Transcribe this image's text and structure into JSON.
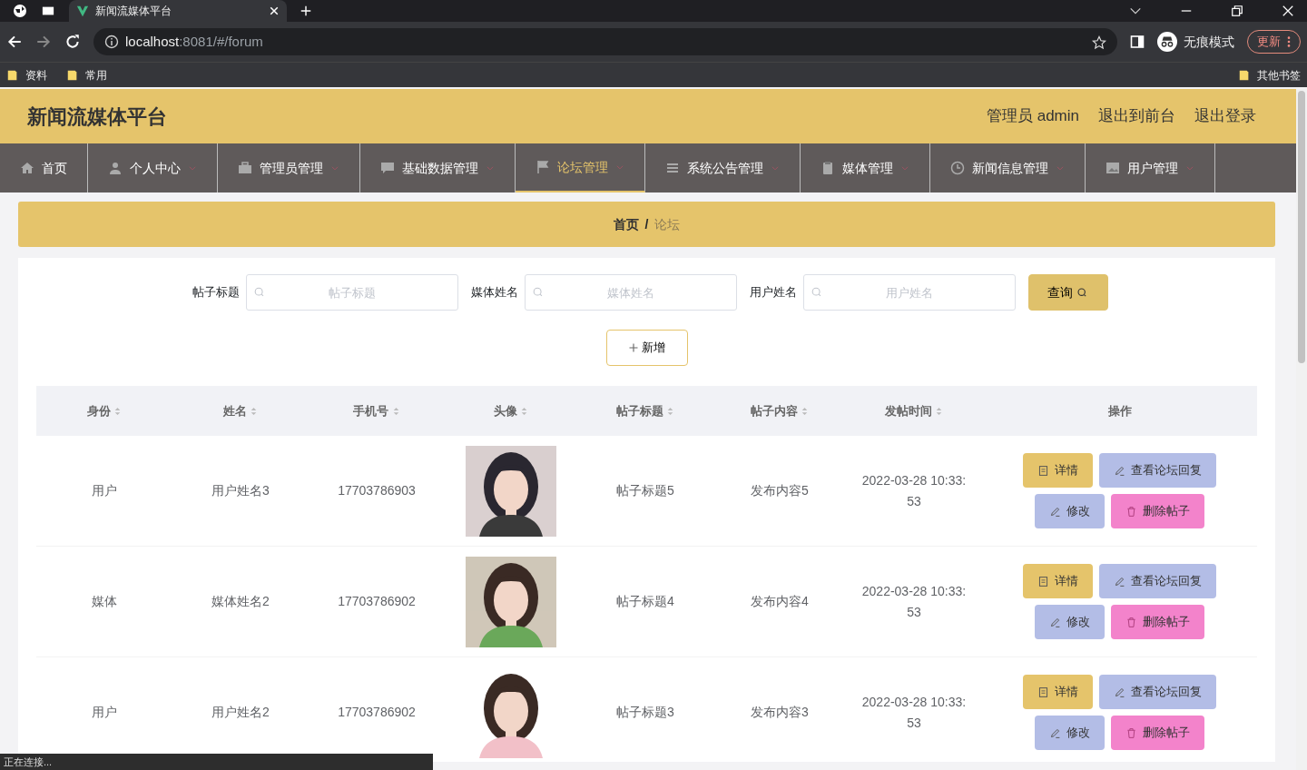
{
  "browser": {
    "tab_title": "新闻流媒体平台",
    "url_host": "localhost",
    "url_rest": ":8081/#/forum",
    "incognito_label": "无痕模式",
    "update_button": "更新",
    "bookmarks": [
      "资料",
      "常用"
    ],
    "other_bookmarks": "其他书签"
  },
  "header": {
    "title": "新闻流媒体平台",
    "user": "管理员 admin",
    "links": [
      "退出到前台",
      "退出登录"
    ]
  },
  "nav": [
    {
      "label": "首页",
      "selected": false,
      "dropdown": false
    },
    {
      "label": "个人中心",
      "selected": false,
      "dropdown": true
    },
    {
      "label": "管理员管理",
      "selected": false,
      "dropdown": true
    },
    {
      "label": "基础数据管理",
      "selected": false,
      "dropdown": true
    },
    {
      "label": "论坛管理",
      "selected": true,
      "dropdown": true
    },
    {
      "label": "系统公告管理",
      "selected": false,
      "dropdown": true
    },
    {
      "label": "媒体管理",
      "selected": false,
      "dropdown": true
    },
    {
      "label": "新闻信息管理",
      "selected": false,
      "dropdown": true
    },
    {
      "label": "用户管理",
      "selected": false,
      "dropdown": true
    }
  ],
  "breadcrumb": {
    "separator": "/",
    "items": [
      {
        "label": "首页",
        "current": false
      },
      {
        "label": "论坛",
        "current": true
      }
    ]
  },
  "search": {
    "fields": [
      {
        "label": "帖子标题",
        "placeholder": "帖子标题"
      },
      {
        "label": "媒体姓名",
        "placeholder": "媒体姓名"
      },
      {
        "label": "用户姓名",
        "placeholder": "用户姓名"
      }
    ],
    "button": "查询"
  },
  "add_button": "新增",
  "table": {
    "columns": [
      {
        "label": "身份",
        "sortable": true
      },
      {
        "label": "姓名",
        "sortable": true
      },
      {
        "label": "手机号",
        "sortable": true
      },
      {
        "label": "头像",
        "sortable": true
      },
      {
        "label": "帖子标题",
        "sortable": true
      },
      {
        "label": "帖子内容",
        "sortable": true
      },
      {
        "label": "发帖时间",
        "sortable": true
      },
      {
        "label": "操作",
        "sortable": false
      }
    ],
    "rows": [
      {
        "identity": "用户",
        "name": "用户姓名3",
        "phone": "17703786903",
        "title": "帖子标题5",
        "content": "发布内容5",
        "time": "2022-03-28 10:33:53",
        "actions": [
          {
            "kind": "detail",
            "label": "详情"
          },
          {
            "kind": "reply",
            "label": "查看论坛回复"
          },
          {
            "kind": "edit",
            "label": "修改"
          },
          {
            "kind": "delete",
            "label": "删除帖子"
          }
        ]
      },
      {
        "identity": "媒体",
        "name": "媒体姓名2",
        "phone": "17703786902",
        "title": "帖子标题4",
        "content": "发布内容4",
        "time": "2022-03-28 10:33:53",
        "actions": [
          {
            "kind": "detail",
            "label": "详情"
          },
          {
            "kind": "reply",
            "label": "查看论坛回复"
          },
          {
            "kind": "edit",
            "label": "修改"
          },
          {
            "kind": "delete",
            "label": "删除帖子"
          }
        ]
      },
      {
        "identity": "用户",
        "name": "用户姓名2",
        "phone": "17703786902",
        "title": "帖子标题3",
        "content": "发布内容3",
        "time": "2022-03-28 10:33:53",
        "actions": [
          {
            "kind": "detail",
            "label": "详情"
          },
          {
            "kind": "reply",
            "label": "查看论坛回复"
          },
          {
            "kind": "edit",
            "label": "修改"
          },
          {
            "kind": "delete",
            "label": "删除帖子"
          }
        ]
      }
    ]
  },
  "status_bar": "正在连接..."
}
